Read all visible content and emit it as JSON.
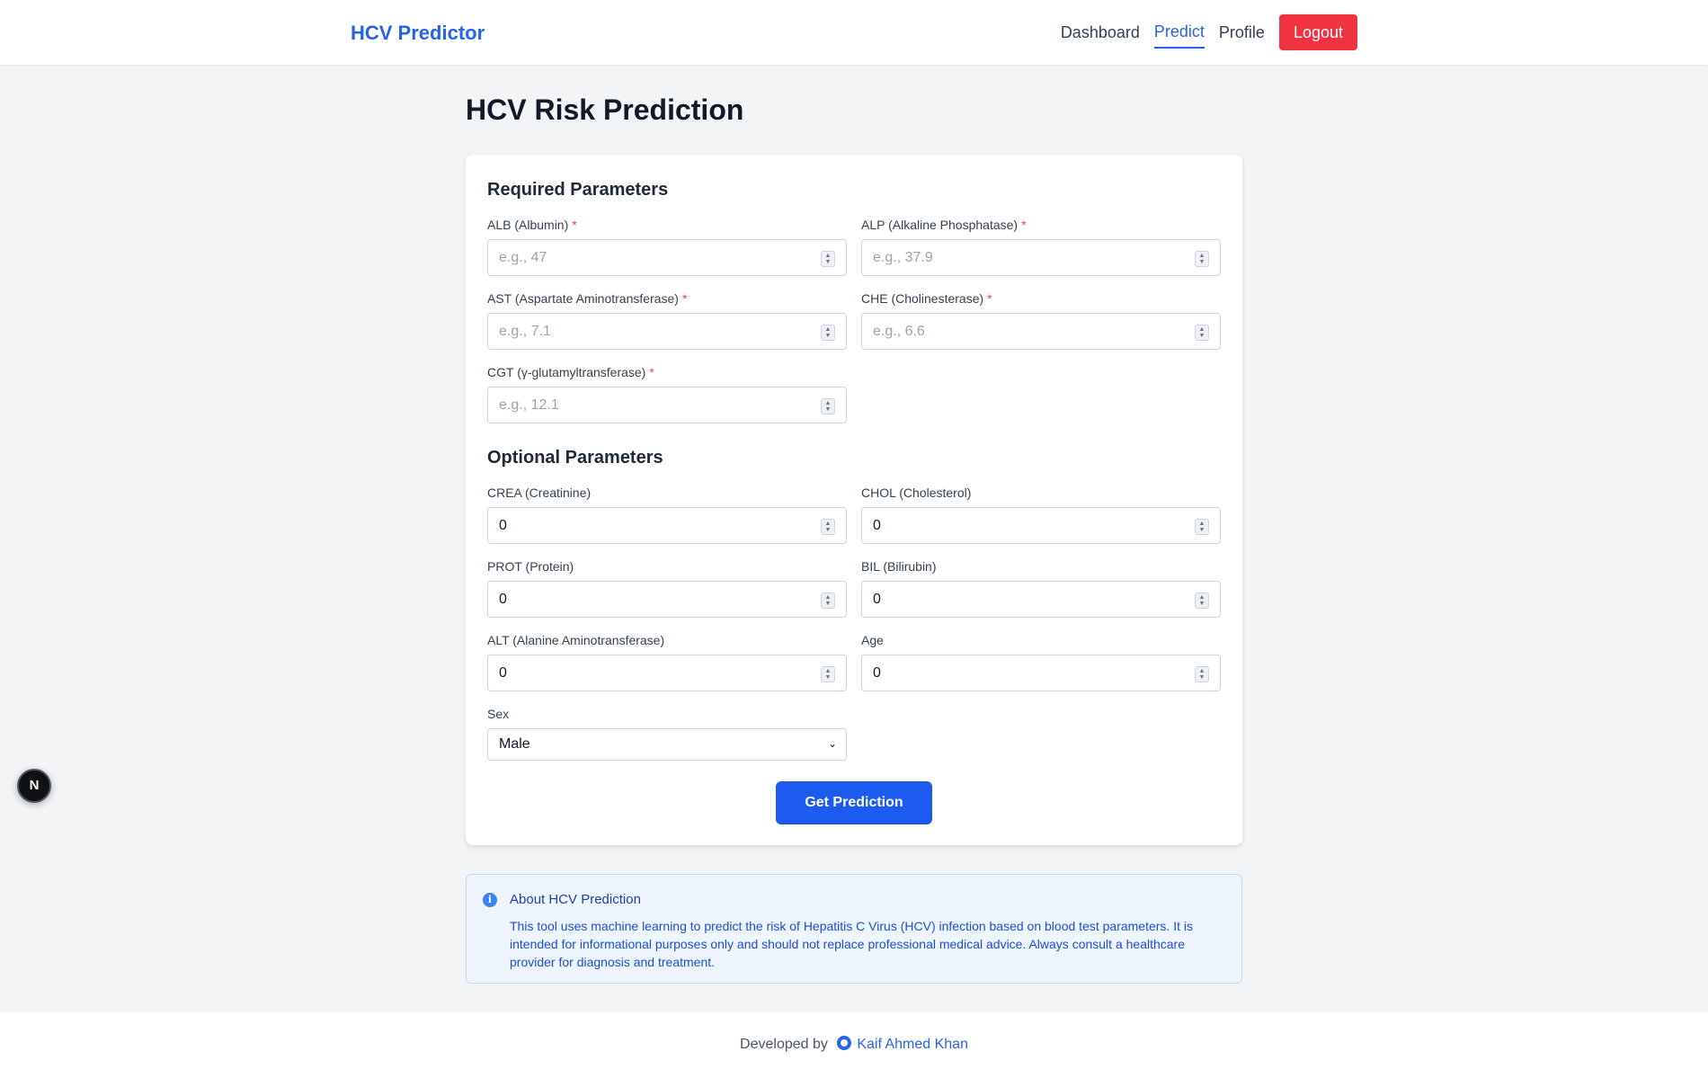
{
  "header": {
    "brand": "HCV Predictor",
    "nav": [
      "Dashboard",
      "Predict",
      "Profile"
    ],
    "active_nav": "Predict",
    "logout_label": "Logout"
  },
  "page": {
    "title": "HCV Risk Prediction"
  },
  "form": {
    "required_title": "Required Parameters",
    "optional_title": "Optional Parameters",
    "required": [
      {
        "label": "ALB (Albumin)",
        "placeholder": "e.g., 47",
        "value": ""
      },
      {
        "label": "ALP (Alkaline Phosphatase)",
        "placeholder": "e.g., 37.9",
        "value": ""
      },
      {
        "label": "AST (Aspartate Aminotransferase)",
        "placeholder": "e.g., 7.1",
        "value": ""
      },
      {
        "label": "CHE (Cholinesterase)",
        "placeholder": "e.g., 6.6",
        "value": ""
      },
      {
        "label": "CGT (γ-glutamyltransferase)",
        "placeholder": "e.g., 12.1",
        "value": ""
      }
    ],
    "required_marker": "*",
    "optional": [
      {
        "label": "CREA (Creatinine)",
        "value": "0"
      },
      {
        "label": "CHOL (Cholesterol)",
        "value": "0"
      },
      {
        "label": "PROT (Protein)",
        "value": "0"
      },
      {
        "label": "BIL (Bilirubin)",
        "value": "0"
      },
      {
        "label": "ALT (Alanine Aminotransferase)",
        "value": "0"
      },
      {
        "label": "Age",
        "value": "0"
      }
    ],
    "sex": {
      "label": "Sex",
      "value": "Male"
    },
    "submit_label": "Get Prediction"
  },
  "info": {
    "icon": "info-icon",
    "title": "About HCV Prediction",
    "text": "This tool uses machine learning to predict the risk of Hepatitis C Virus (HCV) infection based on blood test parameters. It is intended for informational purposes only and should not replace professional medical advice. Always consult a healthcare provider for diagnosis and treatment."
  },
  "footer": {
    "prefix": "Developed by",
    "icon": "github-icon",
    "author": "Kaif Ahmed Khan"
  },
  "badge": {
    "letter": "N",
    "icon": "nextjs-icon"
  },
  "colors": {
    "primary": "#2563eb",
    "danger": "#ef3340",
    "button": "#1d5bf0"
  }
}
